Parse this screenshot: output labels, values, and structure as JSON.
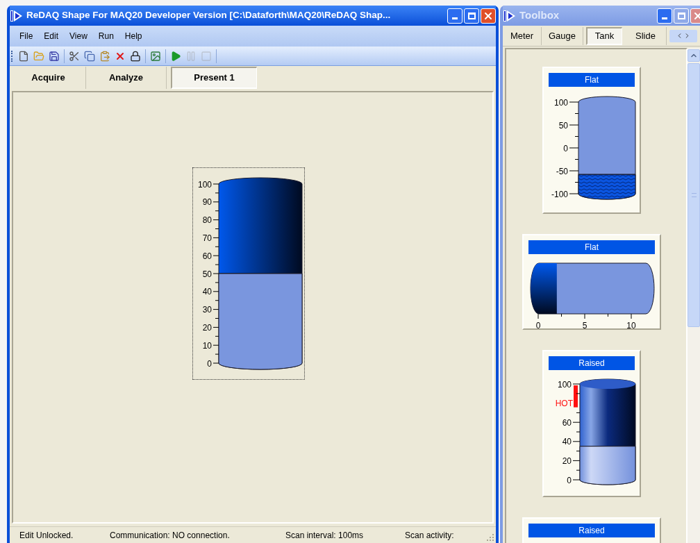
{
  "main_window": {
    "title": "ReDAQ Shape For MAQ20 Developer Version [C:\\Dataforth\\MAQ20\\ReDAQ Shap...",
    "menu": [
      "File",
      "Edit",
      "View",
      "Run",
      "Help"
    ],
    "toolbar": [
      {
        "disabled": false
      },
      {
        "disabled": false
      },
      {
        "disabled": false
      },
      {
        "disabled": false
      },
      {
        "disabled": false
      },
      {
        "disabled": false
      },
      {
        "disabled": false
      },
      {
        "disabled": false
      },
      {
        "disabled": false
      },
      {
        "disabled": false
      },
      {
        "disabled": true
      },
      {
        "disabled": true
      }
    ],
    "tabs": [
      {
        "label": "Acquire",
        "selected": false
      },
      {
        "label": "Analyze",
        "selected": false
      },
      {
        "label": "Present 1",
        "selected": true
      }
    ],
    "canvas_tank": {
      "kind": "gradient",
      "selected": true,
      "level": 0.5,
      "scale": [
        {
          "label": "100",
          "kind": "tick"
        },
        {
          "label": "90",
          "kind": "tick"
        },
        {
          "label": "80",
          "kind": "tick"
        },
        {
          "label": "70",
          "kind": "tick"
        },
        {
          "label": "60",
          "kind": "tick"
        },
        {
          "label": "50",
          "kind": "tick"
        },
        {
          "label": "40",
          "kind": "tick"
        },
        {
          "label": "30",
          "kind": "tick"
        },
        {
          "label": "20",
          "kind": "tick"
        },
        {
          "label": "10",
          "kind": "tick"
        },
        {
          "label": "0",
          "kind": "tick"
        }
      ]
    },
    "status_bar": [
      "Edit Unlocked.",
      "Communication: NO connection.",
      "Scan interval: 100ms",
      "Scan activity:"
    ]
  },
  "toolbox": {
    "title": "Toolbox",
    "tabs": [
      {
        "label": "Meter",
        "selected": false
      },
      {
        "label": "Gauge",
        "selected": false
      },
      {
        "label": "Tank",
        "selected": true
      },
      {
        "label": "Slide",
        "selected": false
      }
    ],
    "cards": [
      {
        "title": "Flat",
        "kind": "narrow",
        "tank": {
          "kind": "hatched",
          "level": 0.21,
          "scale": [
            {
              "label": "100",
              "kind": "tick"
            },
            {
              "label": "50",
              "kind": "tick"
            },
            {
              "label": "0",
              "kind": "tick"
            },
            {
              "label": "-50",
              "kind": "tick"
            },
            {
              "label": "-100",
              "kind": "tick"
            }
          ]
        }
      },
      {
        "title": "Flat",
        "kind": "wide",
        "tank": {
          "kind": "horizontal",
          "level": 0.2,
          "scale": [
            {
              "label": "0",
              "kind": "tick"
            },
            {
              "label": "5",
              "kind": "tick"
            },
            {
              "label": "10",
              "kind": "tick"
            }
          ]
        }
      },
      {
        "title": "Raised",
        "kind": "narrow",
        "tank": {
          "kind": "raised",
          "level": 0.35,
          "scale": [
            {
              "label": "100",
              "kind": "tick"
            },
            {
              "label": "HOT",
              "kind": "alarm"
            },
            {
              "label": "60",
              "kind": "tick"
            },
            {
              "label": "40",
              "kind": "tick"
            },
            {
              "label": "20",
              "kind": "tick"
            },
            {
              "label": "0",
              "kind": "tick"
            }
          ]
        }
      },
      {
        "title": "Raised",
        "kind": "wide"
      }
    ]
  }
}
